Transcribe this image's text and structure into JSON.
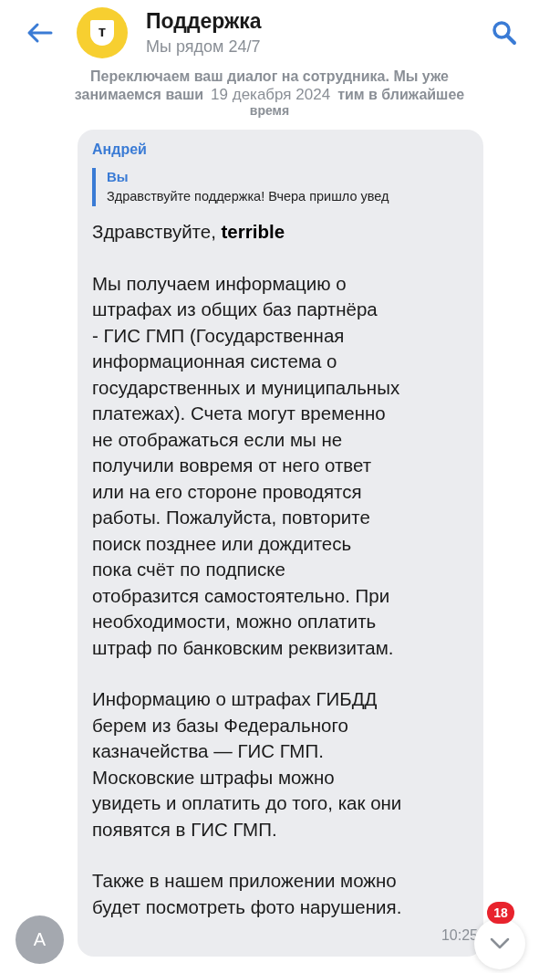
{
  "header": {
    "title": "Поддержка",
    "subtitle": "Мы рядом 24/7",
    "logo_letter": "т"
  },
  "system_note": {
    "lines": [
      "Переключаем ваш диалог на сотрудника. Мы уже",
      "занимаемся ваши",
      "тим в ближайшее",
      "время"
    ]
  },
  "date": "19 декабря 2024",
  "message": {
    "sender": "Андрей",
    "avatar_letter": "А",
    "reply": {
      "author": "Вы",
      "text": "Здравствуйте поддержка! Вчера пришло увед"
    },
    "paragraphs": [
      "Здравствуйте,  **terrible**",
      "Мы получаем информацию о\nштрафах из общих баз партнёра\n- ГИС ГМП (Государственная\nинформационная система о\nгосударственных и муниципальных\nплатежах). Счета могут временно\nне отображаться если мы не\nполучили вовремя от него ответ\nили на его стороне проводятся\nработы. Пожалуйста, повторите\nпоиск позднее или дождитесь\nпока счёт по подписке\nотобразится самостоятельно. При\nнеобходимости, можно оплатить\nштраф по банковским реквизитам.",
      "Информацию о штрафах ГИБДД\nберем из базы Федерального\nказначейства — ГИС ГМП.\nМосковские штрафы можно\nувидеть и оплатить до того, как они\nпоявятся в ГИС ГМП.",
      "Также в нашем приложении можно\nбудет посмотреть фото нарушения."
    ],
    "time": "10:25"
  },
  "scroll_button": {
    "badge": "18"
  }
}
